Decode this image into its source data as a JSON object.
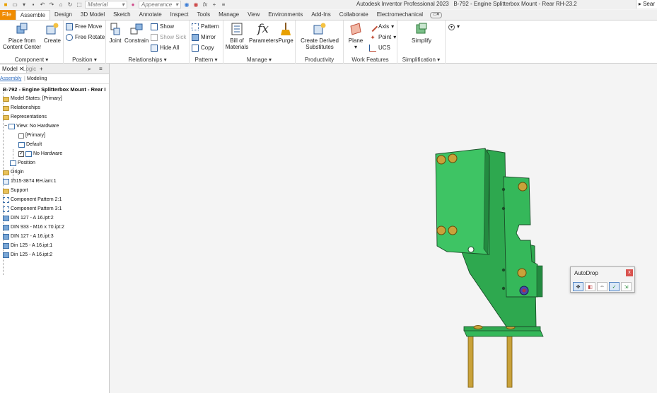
{
  "titlebar": {
    "material_placeholder": "Material",
    "appearance_placeholder": "Appearance",
    "app_title": "Autodesk Inventor Professional 2023",
    "doc_title": "B-792 - Engine Splitterbox Mount - Rear RH-23.2",
    "search_label": "Sear"
  },
  "tabs": [
    "File",
    "Assemble",
    "Design",
    "3D Model",
    "Sketch",
    "Annotate",
    "Inspect",
    "Tools",
    "Manage",
    "View",
    "Environments",
    "Add-Ins",
    "Collaborate",
    "Electromechanical"
  ],
  "active_tab": "Assemble",
  "ribbon": {
    "component": {
      "title": "Component",
      "place_line1": "Place from",
      "place_line2": "Content Center",
      "create": "Create"
    },
    "position": {
      "title": "Position",
      "free_move": "Free Move",
      "free_rotate": "Free Rotate"
    },
    "relationships": {
      "title": "Relationships",
      "joint": "Joint",
      "constrain": "Constrain",
      "show": "Show",
      "show_sick": "Show Sick",
      "hide_all": "Hide All"
    },
    "pattern": {
      "title": "Pattern",
      "pattern": "Pattern",
      "mirror": "Mirror",
      "copy": "Copy"
    },
    "manage": {
      "title": "Manage",
      "bom_line1": "Bill of",
      "bom_line2": "Materials",
      "parameters": "Parameters",
      "purge": "Purge"
    },
    "productivity": {
      "title": "Productivity",
      "cds_line1": "Create Derived",
      "cds_line2": "Substitutes"
    },
    "work_features": {
      "title": "Work Features",
      "plane": "Plane",
      "axis": "Axis",
      "point": "Point",
      "ucs": "UCS"
    },
    "simplification": {
      "title": "Simplification",
      "simplify": "Simplify"
    }
  },
  "browser": {
    "tab_model": "Model",
    "tab_logic": "Logic",
    "sub_assembly": "Assembly",
    "sub_modeling": "Modeling",
    "root": "B-792 - Engine Splitterbox Mount - Rear I",
    "items": [
      "Model States: [Primary]",
      "Relationships",
      "Representations",
      "View: No Hardware",
      "[Primary]",
      "Default",
      "No Hardware",
      "Position",
      "Origin",
      "1515-3874 RH.iam:1",
      "Support",
      "Component Pattern 2:1",
      "Component Pattern 3:1",
      "DIN 127 - A 16.ipt:2",
      "DIN 933 - M16 x 70.ipt:2",
      "DIN 127 - A 16.ipt:3",
      "Din 125 - A 16.ipt:1",
      "Din 125 - A 16.ipt:2"
    ]
  },
  "autodrop": {
    "title": "AutoDrop",
    "close": "x"
  },
  "colors": {
    "file_tab": "#f08c00",
    "part_green": "#2ea84f",
    "bolt_gold": "#c9a23a"
  }
}
